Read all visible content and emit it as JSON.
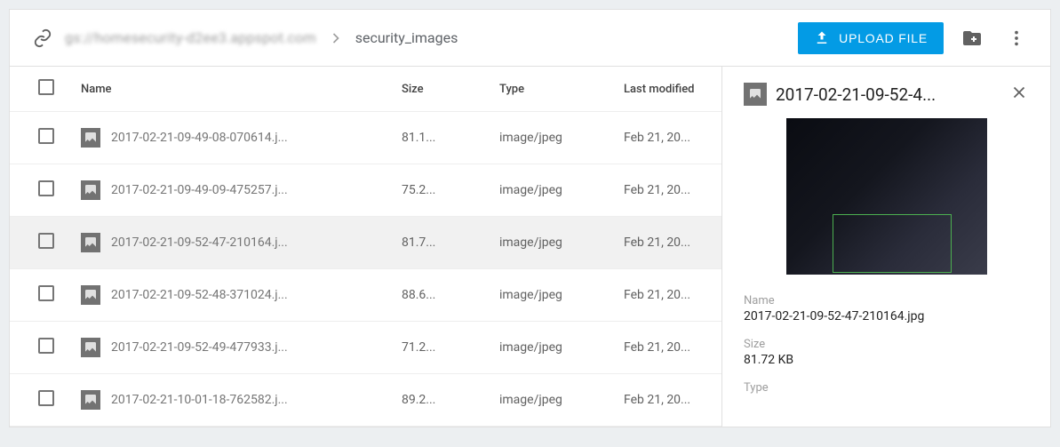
{
  "toolbar": {
    "bucket": "gs://homesecurity-d2ee3.appspot.com",
    "folder": "security_images",
    "upload_label": "UPLOAD FILE"
  },
  "columns": {
    "name": "Name",
    "size": "Size",
    "type": "Type",
    "modified": "Last modified"
  },
  "rows": [
    {
      "name": "2017-02-21-09-49-08-070614.j...",
      "size": "81.1...",
      "type": "image/jpeg",
      "modified": "Feb 21, 20...",
      "selected": false
    },
    {
      "name": "2017-02-21-09-49-09-475257.j...",
      "size": "75.2...",
      "type": "image/jpeg",
      "modified": "Feb 21, 20...",
      "selected": false
    },
    {
      "name": "2017-02-21-09-52-47-210164.j...",
      "size": "81.7...",
      "type": "image/jpeg",
      "modified": "Feb 21, 20...",
      "selected": true
    },
    {
      "name": "2017-02-21-09-52-48-371024.j...",
      "size": "88.6...",
      "type": "image/jpeg",
      "modified": "Feb 21, 20...",
      "selected": false
    },
    {
      "name": "2017-02-21-09-52-49-477933.j...",
      "size": "71.2...",
      "type": "image/jpeg",
      "modified": "Feb 21, 20...",
      "selected": false
    },
    {
      "name": "2017-02-21-10-01-18-762582.j...",
      "size": "89.2...",
      "type": "image/jpeg",
      "modified": "Feb 21, 20...",
      "selected": false
    }
  ],
  "detail": {
    "title": "2017-02-21-09-52-4...",
    "name_label": "Name",
    "name_value": "2017-02-21-09-52-47-210164.jpg",
    "size_label": "Size",
    "size_value": "81.72 KB",
    "type_label": "Type"
  }
}
